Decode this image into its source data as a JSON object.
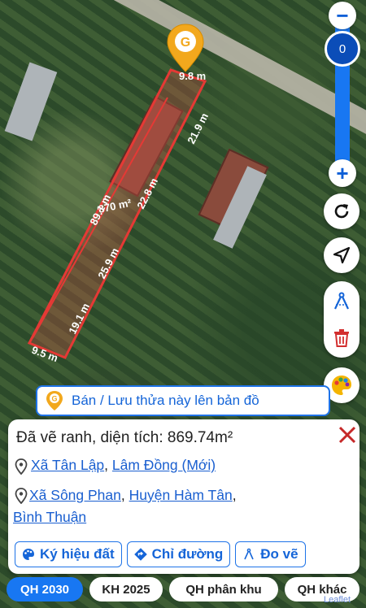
{
  "map": {
    "parcel": {
      "area_label": "870 m²",
      "edge_labels": [
        "9.8 m",
        "21.9 m",
        "22.8 m",
        "25.9 m",
        "19.1 m",
        "9.5 m",
        "89.1 m"
      ]
    },
    "pin_icon": "location-pin-logo"
  },
  "controls": {
    "zoom_out": "−",
    "zoom_level": "0",
    "zoom_in": "+",
    "icons": [
      "refresh-icon",
      "navigate-arrow-icon",
      "compass-draw-icon",
      "trash-icon",
      "palette-icon"
    ]
  },
  "banner": {
    "label": "Bán / Lưu thửa này lên bản đồ"
  },
  "card": {
    "title": "Đã vẽ ranh, diện tích: 869.74m²",
    "location_new": {
      "commune": "Xã Tân Lập",
      "province": "Lâm Đồng (Mới)"
    },
    "location_old": {
      "commune": "Xã Sông Phan",
      "district": "Huyện Hàm Tân",
      "province": "Bình Thuận"
    },
    "chips": [
      "Ký hiệu đất",
      "Chỉ đường",
      "Đo vẽ"
    ]
  },
  "tabs": [
    "QH 2030",
    "KH 2025",
    "QH phân khu",
    "QH khác"
  ],
  "active_tab": "QH 2030",
  "attribution": "Leaflet",
  "colors": {
    "accent": "#1877f2",
    "parcel_line": "#e53935",
    "close": "#c62828",
    "pin": "#f2a81d"
  }
}
